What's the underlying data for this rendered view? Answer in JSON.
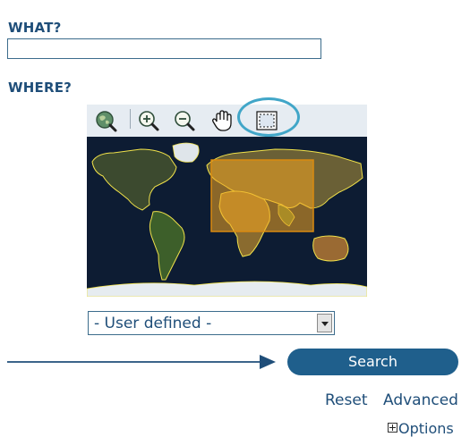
{
  "what": {
    "label": "WHAT?",
    "input_value": "",
    "placeholder": ""
  },
  "where": {
    "label": "WHERE?",
    "toolbar": {
      "tools": [
        {
          "name": "zoom-to-world-icon"
        },
        {
          "name": "zoom-in-icon"
        },
        {
          "name": "zoom-out-icon"
        },
        {
          "name": "pan-hand-icon"
        },
        {
          "name": "draw-box-icon",
          "highlighted": true
        }
      ]
    },
    "map": {
      "type": "world-map",
      "selection": "orange-box"
    },
    "region_select": {
      "selected": "- User defined -"
    }
  },
  "actions": {
    "search_label": "Search",
    "reset_label": "Reset",
    "advanced_label": "Advanced",
    "options_label": "Options"
  },
  "colors": {
    "label": "#1f4e79",
    "button": "#1f5f8c",
    "highlight": "#41a6c8",
    "selection": "#f4a521"
  }
}
